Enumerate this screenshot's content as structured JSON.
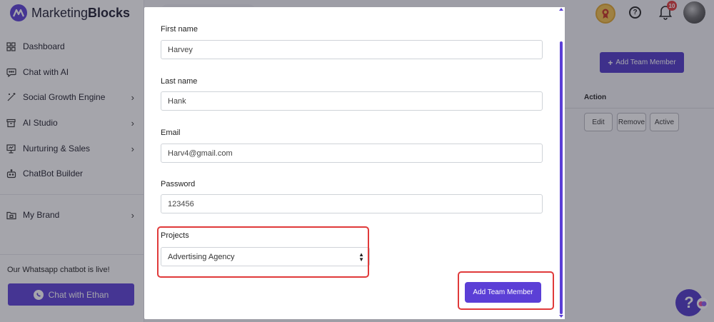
{
  "app": {
    "brand": "Marketing",
    "brand_bold": "Blocks"
  },
  "sidebar": {
    "items": [
      {
        "label": "Dashboard",
        "icon": "grid-icon",
        "has_chevron": false
      },
      {
        "label": "Chat with AI",
        "icon": "chat-icon",
        "has_chevron": false
      },
      {
        "label": "Social Growth Engine",
        "icon": "wand-icon",
        "has_chevron": true
      },
      {
        "label": "AI Studio",
        "icon": "archive-icon",
        "has_chevron": true
      },
      {
        "label": "Nurturing & Sales",
        "icon": "presentation-icon",
        "has_chevron": true
      },
      {
        "label": "ChatBot Builder",
        "icon": "bot-icon",
        "has_chevron": false
      },
      {
        "label": "My Brand",
        "icon": "folder-icon",
        "has_chevron": true
      }
    ],
    "promo_text": "Our Whatsapp chatbot is live!",
    "chat_button_label": "Chat with Ethan"
  },
  "header": {
    "notification_count": "10"
  },
  "page": {
    "add_team_member_label": "Add Team Member",
    "table_header_action": "Action",
    "row_actions": [
      "Edit",
      "Remove",
      "Active"
    ]
  },
  "modal": {
    "first_name": {
      "label": "First name",
      "value": "Harvey"
    },
    "last_name": {
      "label": "Last name",
      "value": "Hank"
    },
    "email": {
      "label": "Email",
      "value": "Harv4@gmail.com"
    },
    "password": {
      "label": "Password",
      "value": "123456"
    },
    "projects": {
      "label": "Projects",
      "selected": "Advertising Agency"
    },
    "submit_label": "Add Team Member"
  },
  "help_bubble": "?",
  "colors": {
    "accent": "#5b3fd6",
    "highlight": "#e03a3a"
  }
}
